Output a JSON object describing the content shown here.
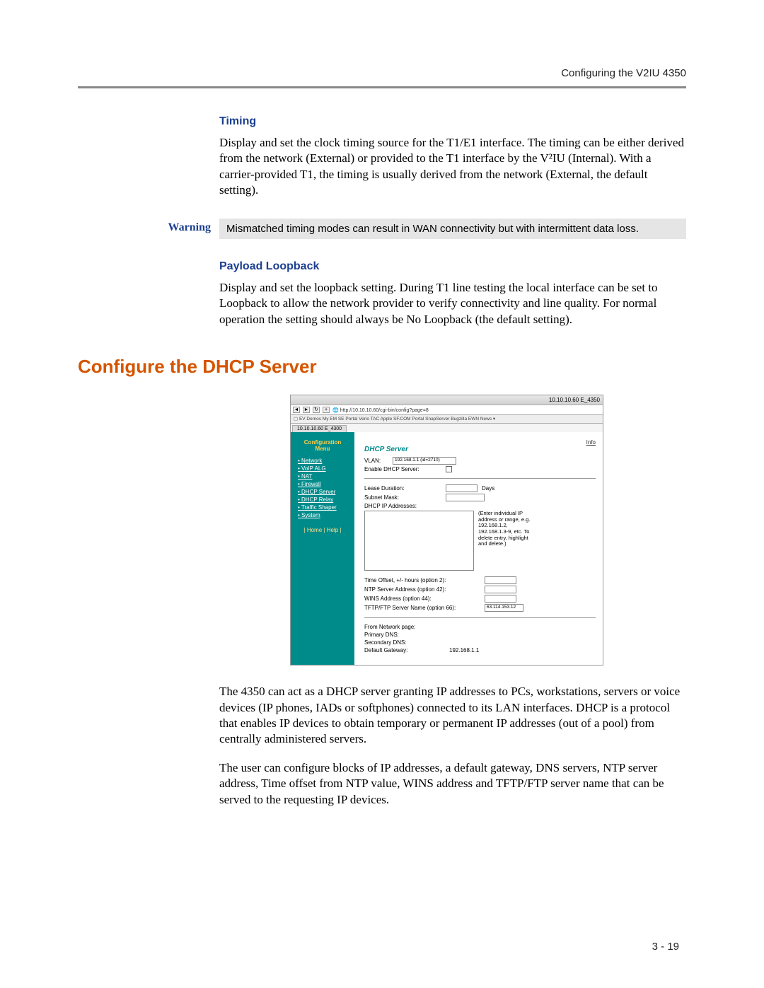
{
  "header": {
    "running": "Configuring the V2IU 4350"
  },
  "timing": {
    "heading": "Timing",
    "para": "Display and set the clock timing source for the T1/E1 interface. The timing can be either derived from the network (External) or provided to the T1 interface by the V²IU (Internal). With a carrier-provided T1, the timing is usually derived from the network (External, the default setting)."
  },
  "warning": {
    "label": "Warning",
    "text": "Mismatched timing modes can result in WAN connectivity but with intermittent data loss."
  },
  "payload": {
    "heading": "Payload Loopback",
    "para": "Display and set the loopback setting. During T1 line testing the local interface can be set to Loopback to allow the network provider to verify connectivity and line quality. For normal operation the setting should always be No Loopback (the default setting)."
  },
  "dhcp": {
    "heading": "Configure the DHCP Server",
    "para1": "The 4350 can act as a DHCP server granting IP addresses to PCs, workstations, servers or voice devices (IP phones, IADs or softphones) connected to its LAN interfaces. DHCP is a protocol that enables IP devices to obtain temporary or permanent IP addresses (out of a pool) from centrally administered servers.",
    "para2": "The user can configure blocks of IP addresses, a default gateway, DNS servers, NTP server address, Time offset from NTP value, WINS address and TFTP/FTP server name that can be served to the requesting IP devices."
  },
  "screenshot": {
    "window_title": "10.10.10.60 E_4350",
    "url": "http://10.10.10.60/cgi-bin/config?page=8",
    "bookmarks": "EV Demos   My EM   SE Portal   Verio TAC   Apple   SF.COM   Portal   SnapServer   Bugzilla   EWN   News ▾",
    "tab": "10.10.10.60 E_4300",
    "sidebar_title1": "Configuration",
    "sidebar_title2": "Menu",
    "nav": [
      "Network",
      "VoIP ALG",
      "NAT",
      "Firewall",
      "DHCP Server",
      "DHCP Relay",
      "Traffic Shaper",
      "System"
    ],
    "home_help": "| Home | Help |",
    "info": "Info",
    "panel_title": "DHCP Server",
    "vlan_label": "VLAN:",
    "vlan_value": "192.168.1.1 (id=2710)",
    "enable_label": "Enable DHCP Server:",
    "lease_label": "Lease Duration:",
    "lease_unit": "Days",
    "subnet_label": "Subnet Mask:",
    "ip_label": "DHCP IP Addresses:",
    "ip_hint": "(Enter individual IP address or range, e.g. 192.168.1.2, 192.168.1.3-9, etc. To delete entry, highlight and delete.)",
    "time_offset": "Time Offset, +/- hours (option 2):",
    "ntp": "NTP Server Address (option 42):",
    "wins": "WINS Address (option 44):",
    "tftp": "TFTP/FTP Server Name (option 66):",
    "tftp_value": "63.114.153.12",
    "from_net": "From Network page:",
    "pdns": "Primary DNS:",
    "sdns": "Secondary DNS:",
    "gw_label": "Default Gateway:",
    "gw_value": "192.168.1.1"
  },
  "page_number": "3 - 19"
}
